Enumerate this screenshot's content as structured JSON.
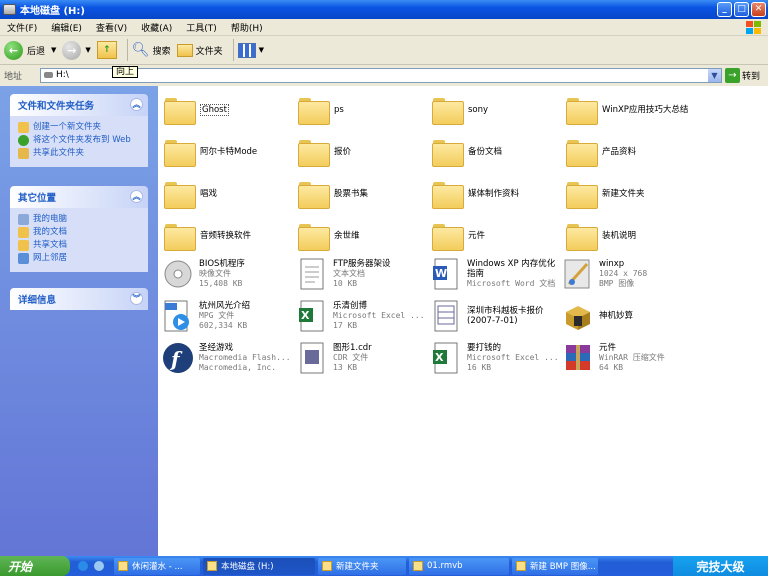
{
  "window": {
    "title": "本地磁盘 (H:)"
  },
  "menu": [
    "文件(F)",
    "编辑(E)",
    "查看(V)",
    "收藏(A)",
    "工具(T)",
    "帮助(H)"
  ],
  "toolbar": {
    "back": "后退",
    "search": "搜索",
    "folders": "文件夹",
    "tooltip": "向上"
  },
  "address": {
    "label": "地址",
    "value": "H:\\",
    "go": "转到"
  },
  "tasks_panel": {
    "title": "文件和文件夹任务",
    "items": [
      "创建一个新文件夹",
      "将这个文件夹发布到 Web",
      "共享此文件夹"
    ]
  },
  "other_panel": {
    "title": "其它位置",
    "items": [
      "我的电脑",
      "我的文档",
      "共享文档",
      "网上邻居"
    ]
  },
  "details_panel": {
    "title": "详细信息"
  },
  "items": [
    {
      "name": "Ghost",
      "kind": "folder"
    },
    {
      "name": "ps",
      "kind": "folder"
    },
    {
      "name": "sony",
      "kind": "folder"
    },
    {
      "name": "WinXP应用技巧大总结",
      "kind": "folder"
    },
    {
      "name": "阿尔卡特Mode",
      "kind": "folder"
    },
    {
      "name": "报价",
      "kind": "folder"
    },
    {
      "name": "备份文档",
      "kind": "folder"
    },
    {
      "name": "产品资料",
      "kind": "folder"
    },
    {
      "name": "唱戏",
      "kind": "folder"
    },
    {
      "name": "股票书集",
      "kind": "folder"
    },
    {
      "name": "媒体制作资料",
      "kind": "folder"
    },
    {
      "name": "新建文件夹",
      "kind": "folder"
    },
    {
      "name": "音频转换软件",
      "kind": "folder"
    },
    {
      "name": "余世维",
      "kind": "folder"
    },
    {
      "name": "元件",
      "kind": "folder"
    },
    {
      "name": "装机说明",
      "kind": "folder"
    },
    {
      "name": "BIOS机程序",
      "type": "映像文件",
      "size": "15,408 KB",
      "kind": "iso"
    },
    {
      "name": "FTP服务器架设",
      "type": "文本文档",
      "size": "10 KB",
      "kind": "txt"
    },
    {
      "name": "Windows XP 内存优化指南",
      "type": "Microsoft Word 文档",
      "size": "",
      "kind": "doc"
    },
    {
      "name": "winxp",
      "type": "1024 x 768",
      "size": "BMP 图像",
      "kind": "bmp"
    },
    {
      "name": "杭州风光介绍",
      "type": "MPG 文件",
      "size": "602,334 KB",
      "kind": "mpg"
    },
    {
      "name": "乐清创博",
      "type": "Microsoft Excel ...",
      "size": "17 KB",
      "kind": "xls"
    },
    {
      "name": "深圳市科越板卡报价 (2007-7-01)",
      "type": "",
      "size": "",
      "kind": "cdr"
    },
    {
      "name": "神机妙算",
      "type": "",
      "size": "",
      "kind": "exe"
    },
    {
      "name": "圣经游戏",
      "type": "Macromedia Flash...",
      "size": "Macromedia, Inc.",
      "kind": "swf"
    },
    {
      "name": "图形1.cdr",
      "type": "CDR 文件",
      "size": "13 KB",
      "kind": "cdr"
    },
    {
      "name": "要打钱的",
      "type": "Microsoft Excel ...",
      "size": "16 KB",
      "kind": "xls"
    },
    {
      "name": "元件",
      "type": "WinRAR 压缩文件",
      "size": "64 KB",
      "kind": "rar"
    }
  ],
  "taskbar": {
    "start": "开始",
    "tasks": [
      "休闲灌水 - ...",
      "本地磁盘 (H:)",
      "新建文件夹",
      "01.rmvb",
      "新建 BMP 图像..."
    ],
    "tray": "完技大级"
  },
  "colors": {
    "title": "#0a54e3",
    "sidebar": "#6f8de0",
    "link": "#215dc6"
  }
}
